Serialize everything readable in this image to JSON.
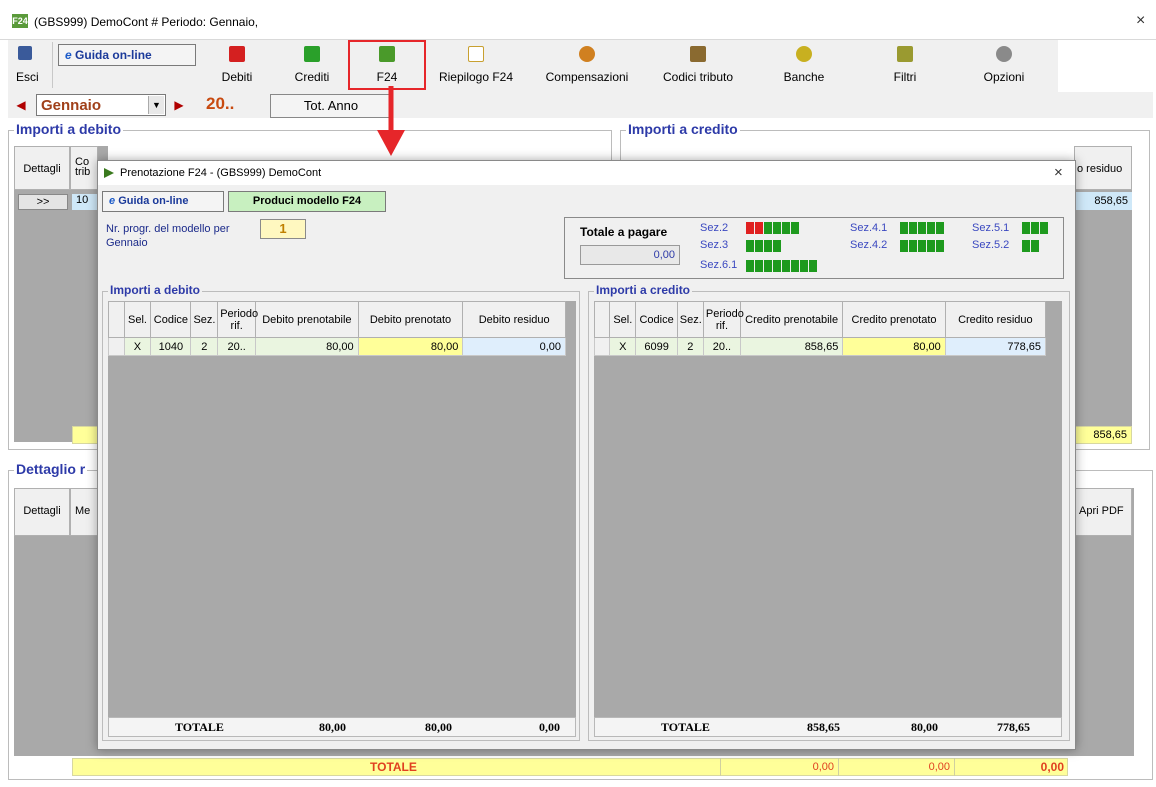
{
  "window": {
    "title": "(GBS999) DemoCont  # Periodo: Gennaio,",
    "app_icon": "F24",
    "close": "×"
  },
  "toolbar": {
    "esci": "Esci",
    "guida": "Guida on-line",
    "buttons": [
      {
        "label": "Debiti",
        "icon": "red-book-icon",
        "color": "#d42020"
      },
      {
        "label": "Crediti",
        "icon": "green-book-icon",
        "color": "#2aa02a"
      },
      {
        "label": "F24",
        "icon": "f24-icon",
        "color": "#4a9a2a"
      },
      {
        "label": "Riepilogo F24",
        "icon": "preview-icon",
        "color": "#c8a030"
      },
      {
        "label": "Compensazioni",
        "icon": "compensation-icon",
        "color": "#d08020"
      },
      {
        "label": "Codici tributo",
        "icon": "tax-code-icon",
        "color": "#8a6a30"
      },
      {
        "label": "Banche",
        "icon": "bank-icon",
        "color": "#c8b020"
      },
      {
        "label": "Filtri",
        "icon": "filter-icon",
        "color": "#9a9a30"
      },
      {
        "label": "Opzioni",
        "icon": "options-icon",
        "color": "#8a8a8a"
      }
    ]
  },
  "nav": {
    "month": "Gennaio",
    "year": "20..",
    "tot_anno": "Tot. Anno"
  },
  "main": {
    "debito_title": "Importi a debito",
    "credito_title": "Importi a credito",
    "dettagli_header": "Dettagli",
    "codice_header_partial": "Co trib",
    "row_button": ">>",
    "row_code_partial": "10",
    "residuo_header_partial": "o residuo",
    "credito_value": "858,65",
    "credito_total": "858,65",
    "dettaglio_title": "Dettaglio r",
    "dettaglio_cols": [
      "Dettagli",
      "Me"
    ],
    "apri_pdf": "Apri PDF",
    "bottom_total_label": "TOTALE",
    "bottom_totals": [
      "0,00",
      "0,00",
      "0,00"
    ]
  },
  "modal": {
    "title": "Prenotazione F24 - (GBS999) DemoCont",
    "close": "×",
    "guida": "Guida on-line",
    "produci": "Produci modello F24",
    "progr_label": "Nr. progr. del modello per",
    "progr_month": "Gennaio",
    "progr_value": "1",
    "totale_label": "Totale a pagare",
    "totale_value": "0,00",
    "sezioni": [
      {
        "label": "Sez.2",
        "colors": [
          "#e02020",
          "#e02020",
          "#1e9a1e",
          "#1e9a1e",
          "#1e9a1e",
          "#1e9a1e"
        ]
      },
      {
        "label": "Sez.3",
        "colors": [
          "#1e9a1e",
          "#1e9a1e",
          "#1e9a1e",
          "#1e9a1e"
        ]
      },
      {
        "label": "Sez.6.1",
        "colors": [
          "#1e9a1e",
          "#1e9a1e",
          "#1e9a1e",
          "#1e9a1e",
          "#1e9a1e",
          "#1e9a1e",
          "#1e9a1e",
          "#1e9a1e"
        ]
      },
      {
        "label": "Sez.4.1",
        "colors": [
          "#1e9a1e",
          "#1e9a1e",
          "#1e9a1e",
          "#1e9a1e",
          "#1e9a1e"
        ]
      },
      {
        "label": "Sez.4.2",
        "colors": [
          "#1e9a1e",
          "#1e9a1e",
          "#1e9a1e",
          "#1e9a1e",
          "#1e9a1e"
        ]
      },
      {
        "label": "Sez.5.1",
        "colors": [
          "#1e9a1e",
          "#1e9a1e",
          "#1e9a1e"
        ]
      },
      {
        "label": "Sez.5.2",
        "colors": [
          "#1e9a1e",
          "#1e9a1e"
        ]
      }
    ],
    "debito": {
      "title": "Importi a debito",
      "headers": [
        "Sel.",
        "Codice",
        "Sez.",
        "Periodo rif.",
        "Debito prenotabile",
        "Debito prenotato",
        "Debito residuo"
      ],
      "row": [
        "X",
        "1040",
        "2",
        "20..",
        "80,00",
        "80,00",
        "0,00"
      ],
      "totale_label": "TOTALE",
      "totals": [
        "80,00",
        "80,00",
        "0,00"
      ]
    },
    "credito": {
      "title": "Importi a credito",
      "headers": [
        "Sel.",
        "Codice",
        "Sez.",
        "Periodo rif.",
        "Credito prenotabile",
        "Credito prenotato",
        "Credito residuo"
      ],
      "row": [
        "X",
        "6099",
        "2",
        "20..",
        "858,65",
        "80,00",
        "778,65"
      ],
      "totale_label": "TOTALE",
      "totals": [
        "858,65",
        "80,00",
        "778,65"
      ]
    }
  },
  "colors": {
    "accent_blue": "#2d3aa8",
    "highlight_red": "#e6262a",
    "yellow_cell": "#ffff99",
    "light_blue_cell": "#dfeefc"
  }
}
